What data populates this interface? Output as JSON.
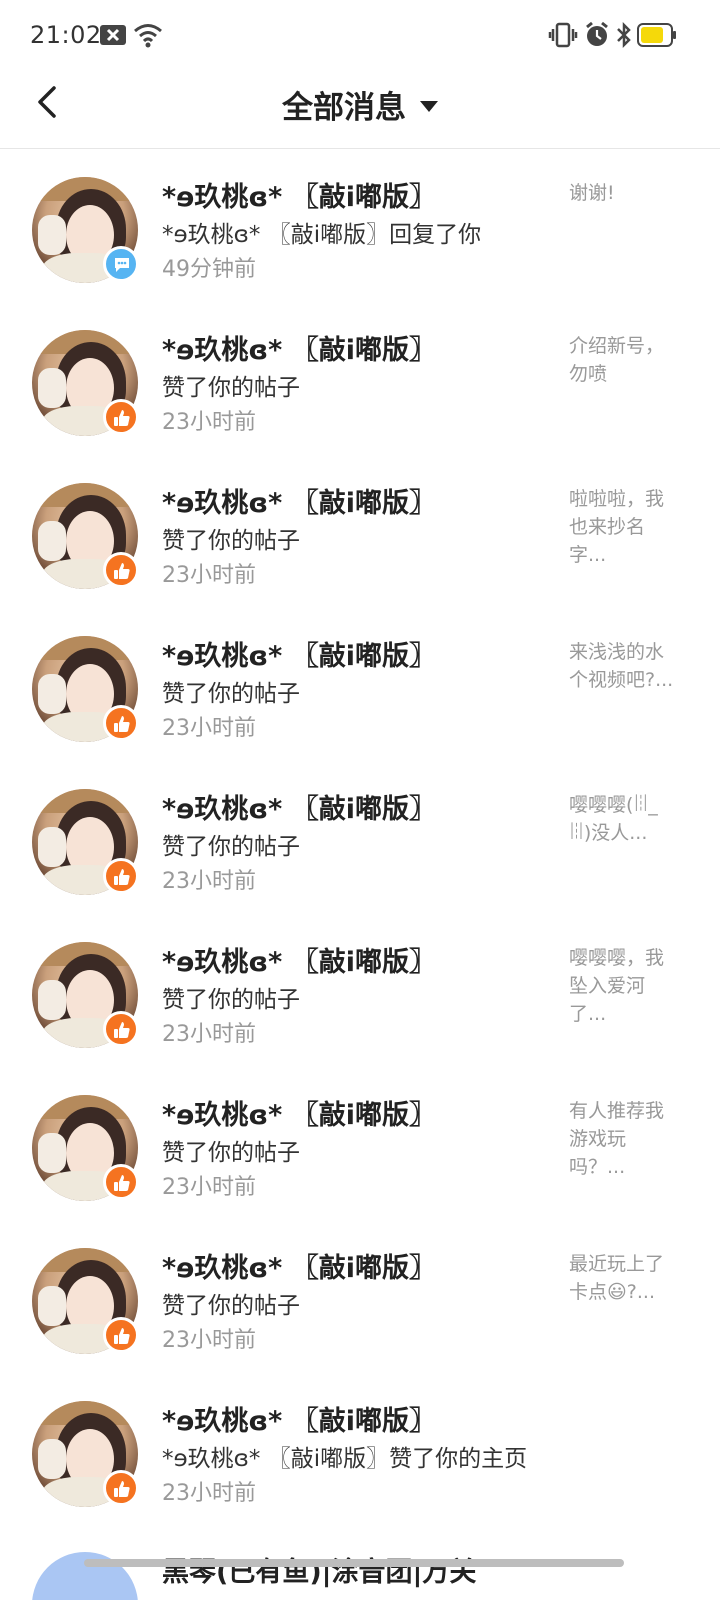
{
  "status_bar": {
    "time": "21:02",
    "icons": [
      "notification-x-icon",
      "wifi-icon",
      "vibrate-icon",
      "alarm-icon",
      "bluetooth-icon",
      "battery-icon"
    ],
    "battery_color": "#f5d90a"
  },
  "header": {
    "title": "全部消息",
    "back_icon": "back-arrow-icon",
    "dropdown_icon": "caret-down-icon"
  },
  "colors": {
    "like_badge": "#f57320",
    "comment_badge": "#56b4f2",
    "secondary_text": "#999999"
  },
  "messages": [
    {
      "name": "*ɘ玖桃ɞ* 〖敲i嘟版〗",
      "action": "*ɘ玖桃ɞ* 〖敲i嘟版〗回复了你",
      "time": "49分钟前",
      "badge": "comment-badge-icon",
      "preview": "谢谢!"
    },
    {
      "name": "*ɘ玖桃ɞ* 〖敲i嘟版〗",
      "action": "赞了你的帖子",
      "time": "23小时前",
      "badge": "like-badge-icon",
      "preview": "介绍新号，勿喷"
    },
    {
      "name": "*ɘ玖桃ɞ* 〖敲i嘟版〗",
      "action": "赞了你的帖子",
      "time": "23小时前",
      "badge": "like-badge-icon",
      "preview": "啦啦啦，我也来抄名字..."
    },
    {
      "name": "*ɘ玖桃ɞ* 〖敲i嘟版〗",
      "action": "赞了你的帖子",
      "time": "23小时前",
      "badge": "like-badge-icon",
      "preview": "来浅浅的水个视频吧?..."
    },
    {
      "name": "*ɘ玖桃ɞ* 〖敲i嘟版〗",
      "action": "赞了你的帖子",
      "time": "23小时前",
      "badge": "like-badge-icon",
      "preview": "嘤嘤嘤(ꈨ_ꈨ)没人..."
    },
    {
      "name": "*ɘ玖桃ɞ* 〖敲i嘟版〗",
      "action": "赞了你的帖子",
      "time": "23小时前",
      "badge": "like-badge-icon",
      "preview": "嘤嘤嘤，我坠入爱河了..."
    },
    {
      "name": "*ɘ玖桃ɞ* 〖敲i嘟版〗",
      "action": "赞了你的帖子",
      "time": "23小时前",
      "badge": "like-badge-icon",
      "preview": "有人推荐我游戏玩吗？..."
    },
    {
      "name": "*ɘ玖桃ɞ* 〖敲i嘟版〗",
      "action": "赞了你的帖子",
      "time": "23小时前",
      "badge": "like-badge-icon",
      "preview": "最近玩上了卡点😃?..."
    },
    {
      "name": "*ɘ玖桃ɞ* 〖敲i嘟版〗",
      "action": "*ɘ玖桃ɞ* 〖敲i嘟版〗赞了你的主页",
      "time": "23小时前",
      "badge": "like-badge-icon",
      "preview": ""
    }
  ],
  "partial_row": {
    "name": "黑琴(已有鱼)|涂音团|万关"
  }
}
